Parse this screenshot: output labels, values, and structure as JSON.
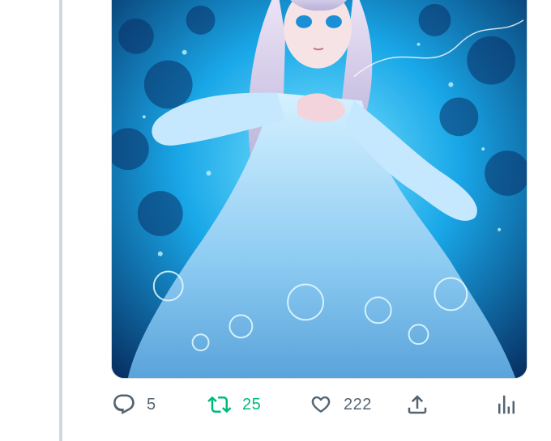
{
  "tweet": {
    "media": {
      "image_alt": ""
    },
    "actions": {
      "reply": {
        "icon": "reply-icon",
        "count": "5"
      },
      "retweet": {
        "icon": "retweet-icon",
        "count": "25",
        "active": true,
        "color": "#00ba7c"
      },
      "like": {
        "icon": "heart-icon",
        "count": "222"
      },
      "share": {
        "icon": "share-icon"
      },
      "analytics": {
        "icon": "analytics-icon"
      }
    }
  },
  "colors": {
    "icon_gray": "#536471",
    "retweet_green": "#00ba7c",
    "thread_line": "#cfd9de"
  }
}
